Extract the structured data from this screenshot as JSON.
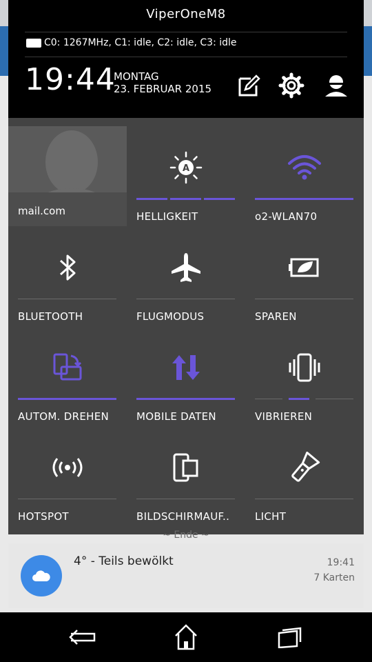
{
  "header": {
    "device_name": "ViperOneM8",
    "cpu_info": "C0: 1267MHz, C1: idle, C2: idle, C3: idle",
    "clock": "19:44",
    "day": "MONTAG",
    "date": "23. FEBRUAR 2015"
  },
  "tiles": {
    "user": {
      "label": "mail.com"
    },
    "brightness": {
      "label": "HELLIGKEIT",
      "icon": "brightness-auto-icon"
    },
    "wifi": {
      "label": "o2-WLAN70",
      "icon": "wifi-icon",
      "active": true
    },
    "bluetooth": {
      "label": "BLUETOOTH",
      "icon": "bluetooth-icon"
    },
    "airplane": {
      "label": "FLUGMODUS",
      "icon": "airplane-icon"
    },
    "battery_saver": {
      "label": "SPAREN",
      "icon": "battery-leaf-icon"
    },
    "auto_rotate": {
      "label": "AUTOM. DREHEN",
      "icon": "rotate-icon",
      "active": true
    },
    "mobile_data": {
      "label": "MOBILE DATEN",
      "icon": "data-arrows-icon",
      "active": true
    },
    "vibrate": {
      "label": "VIBRIEREN",
      "icon": "vibrate-icon"
    },
    "hotspot": {
      "label": "HOTSPOT",
      "icon": "hotspot-icon"
    },
    "screen_record": {
      "label": "BILDSCHIRMAUF..",
      "icon": "screen-record-icon"
    },
    "flashlight": {
      "label": "LICHT",
      "icon": "flashlight-icon"
    }
  },
  "ende": "~ Ende ~",
  "notification": {
    "title": "4° - Teils bewölkt",
    "time": "19:41",
    "sub": "7 Karten",
    "icon": "cloud-icon"
  },
  "colors": {
    "accent": "#6a55d8",
    "tile_bg": "#434343",
    "notification_icon": "#3d8ae6"
  }
}
